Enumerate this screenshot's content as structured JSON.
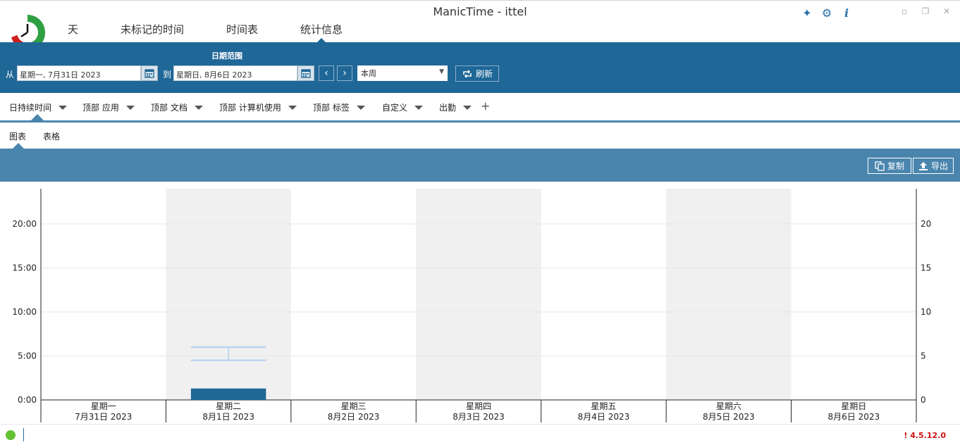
{
  "window": {
    "title": "ManicTime - ittel"
  },
  "main_tabs": [
    {
      "label": "天"
    },
    {
      "label": "未标记的时间"
    },
    {
      "label": "时间表"
    },
    {
      "label": "统计信息"
    }
  ],
  "date_range": {
    "title": "日期范围",
    "from_label": "从",
    "from_value": "星期一, 7月31日 2023",
    "to_label": "到",
    "to_value": "星期日, 8月6日 2023",
    "preset": "本周",
    "refresh_label": "刷新"
  },
  "reports": [
    {
      "label": "日持续时间"
    },
    {
      "label": "顶部 应用"
    },
    {
      "label": "顶部 文档"
    },
    {
      "label": "顶部 计算机使用"
    },
    {
      "label": "顶部 标签"
    },
    {
      "label": "自定义"
    },
    {
      "label": "出勤"
    }
  ],
  "add_report": "+",
  "sub_tabs": [
    {
      "label": "图表"
    },
    {
      "label": "表格"
    }
  ],
  "toolbar": {
    "copy_label": "复制",
    "export_label": "导出"
  },
  "chart_data": {
    "type": "bar",
    "categories": [
      {
        "day": "星期一",
        "date": "7月31日 2023"
      },
      {
        "day": "星期二",
        "date": "8月1日 2023"
      },
      {
        "day": "星期三",
        "date": "8月2日 2023"
      },
      {
        "day": "星期四",
        "date": "8月3日 2023"
      },
      {
        "day": "星期五",
        "date": "8月4日 2023"
      },
      {
        "day": "星期六",
        "date": "8月5日 2023"
      },
      {
        "day": "星期日",
        "date": "8月6日 2023"
      }
    ],
    "values_hours": [
      0,
      1.3,
      0,
      0,
      0,
      0,
      0
    ],
    "range_band": {
      "category": "星期二",
      "low_hours": 4.5,
      "high_hours": 6.0,
      "mid_hours": 5.3
    },
    "shaded_columns": [
      "星期二",
      "星期四",
      "星期六"
    ],
    "ylim": [
      0,
      24
    ],
    "left_ticks": [
      "0:00",
      "5:00",
      "10:00",
      "15:00",
      "20:00"
    ],
    "right_ticks": [
      "0",
      "5",
      "10",
      "15",
      "20"
    ],
    "bar_color": "#1f6797",
    "band_color": "#bcd4ee",
    "shade_color": "#f0f0f0"
  },
  "status": {
    "version": "! 4.5.12.0",
    "indicator_color": "#63c132"
  },
  "colors": {
    "accent": "#1f6797",
    "band": "#4a85ad"
  }
}
